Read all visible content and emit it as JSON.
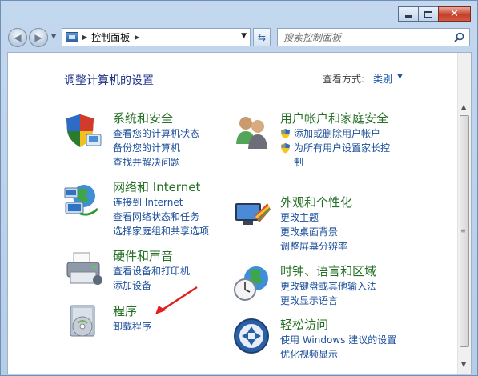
{
  "window": {
    "controls": {
      "minimize": "minimize",
      "maximize": "maximize",
      "close": "✕"
    }
  },
  "address_bar": {
    "location": "控制面板"
  },
  "search": {
    "placeholder": "搜索控制面板"
  },
  "header": {
    "title": "调整计算机的设置",
    "view_by_label": "查看方式:",
    "view_by_value": "类别"
  },
  "categories": [
    {
      "title": "系统和安全",
      "icon": "shield-computer-icon",
      "links": [
        "查看您的计算机状态",
        "备份您的计算机",
        "查找并解决问题"
      ]
    },
    {
      "title": "网络和 Internet",
      "icon": "network-globe-icon",
      "links": [
        "连接到 Internet",
        "查看网络状态和任务",
        "选择家庭组和共享选项"
      ]
    },
    {
      "title": "硬件和声音",
      "icon": "printer-icon",
      "links": [
        "查看设备和打印机",
        "添加设备"
      ]
    },
    {
      "title": "程序",
      "icon": "program-disk-icon",
      "links": [
        "卸载程序"
      ]
    },
    {
      "title": "用户帐户和家庭安全",
      "icon": "users-icon",
      "links": [
        "添加或删除用户帐户",
        "为所有用户设置家长控制"
      ]
    },
    {
      "title": "外观和个性化",
      "icon": "monitor-palette-icon",
      "links": [
        "更改主题",
        "更改桌面背景",
        "调整屏幕分辨率"
      ]
    },
    {
      "title": "时钟、语言和区域",
      "icon": "clock-globe-icon",
      "links": [
        "更改键盘或其他输入法",
        "更改显示语言"
      ]
    },
    {
      "title": "轻松访问",
      "icon": "ease-of-access-icon",
      "links": [
        "使用 Windows 建议的设置",
        "优化视频显示"
      ]
    }
  ],
  "colors": {
    "title_green": "#247024",
    "link_blue": "#1d4f9a",
    "annotation_red": "#e02020"
  }
}
